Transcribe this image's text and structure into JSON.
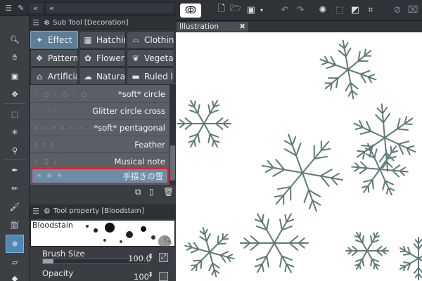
{
  "subtool_panel": {
    "title": "Sub Tool [Decoration]",
    "groups": [
      {
        "label": "Effect",
        "icon": "effect-icon",
        "selected": true
      },
      {
        "label": "Hatching",
        "icon": "hatching-icon",
        "selected": false
      },
      {
        "label": "Clothing",
        "icon": "clothing-icon",
        "selected": false
      },
      {
        "label": "Pattern",
        "icon": "pattern-icon",
        "selected": false
      },
      {
        "label": "Flower",
        "icon": "flower-icon",
        "selected": false
      },
      {
        "label": "Vegetation",
        "icon": "vegetation-icon",
        "selected": false
      },
      {
        "label": "Artificial",
        "icon": "artificial-icon",
        "selected": false
      },
      {
        "label": "Natural",
        "icon": "natural-icon",
        "selected": false
      },
      {
        "label": "Ruled line",
        "icon": "ruled-line-icon",
        "selected": false
      }
    ],
    "brushes": [
      {
        "label": "*soft* circle"
      },
      {
        "label": "Glitter circle cross"
      },
      {
        "label": "*soft* pentagonal"
      },
      {
        "label": "Feather"
      },
      {
        "label": "Musical note"
      },
      {
        "label": "手描きの雪",
        "selected": true
      }
    ]
  },
  "tool_property": {
    "title": "Tool property [Bloodstain]",
    "preview_label": "Bloodstain",
    "brush_size": {
      "label": "Brush Size",
      "value": "100.0",
      "fill": 0.1
    },
    "opacity": {
      "label": "Opacity",
      "value": "100",
      "fill": 1.0
    }
  },
  "document": {
    "tab_label": "Illustration",
    "close": "✖"
  },
  "colors": {
    "accent": "#5d7d97",
    "selection_outline": "#e0202a",
    "snowflake": "#5f7a78"
  }
}
